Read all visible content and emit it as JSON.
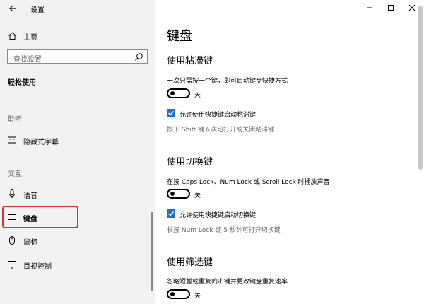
{
  "window": {
    "title": "设置",
    "controls": [
      "minimize-icon",
      "maximize-icon",
      "close-icon"
    ]
  },
  "sidebar": {
    "home_label": "主页",
    "search_placeholder": "查找设置",
    "section_title": "轻松使用",
    "groups": [
      {
        "label": "聆听",
        "items": [
          {
            "label": "隐藏式字幕",
            "icon": "closed-caption-icon"
          }
        ]
      },
      {
        "label": "交互",
        "items": [
          {
            "label": "语音",
            "icon": "microphone-icon"
          },
          {
            "label": "键盘",
            "icon": "keyboard-icon",
            "selected": true
          },
          {
            "label": "鼠标",
            "icon": "mouse-icon"
          },
          {
            "label": "目视控制",
            "icon": "eye-control-icon"
          }
        ]
      }
    ]
  },
  "main": {
    "title": "键盘",
    "sticky": {
      "heading": "使用粘滞键",
      "description": "一次只需按一个键，即可启动键盘快捷方式",
      "toggle_state": "关",
      "checkbox_label": "允许使用快捷键启动粘滞键",
      "checkbox_checked": true,
      "hint": "按下 Shift 键五次可打开或关闭粘滞键"
    },
    "toggle_keys": {
      "heading": "使用切换键",
      "description": "在按 Caps Lock、Num Lock 或 Scroll Lock 时播放声音",
      "toggle_state": "关",
      "checkbox_label": "允许使用快捷键启动切换键",
      "checkbox_checked": true,
      "hint": "长按 Num Lock 键 5 秒钟可打开切换键"
    },
    "filter": {
      "heading": "使用筛选键",
      "description": "忽略短暂或重复的击键并更改键盘重复速率",
      "toggle_state": "关"
    }
  },
  "colors": {
    "sidebar_bg": "#f2f2f2",
    "accent": "#1a73d9",
    "highlight": "#e03030"
  }
}
